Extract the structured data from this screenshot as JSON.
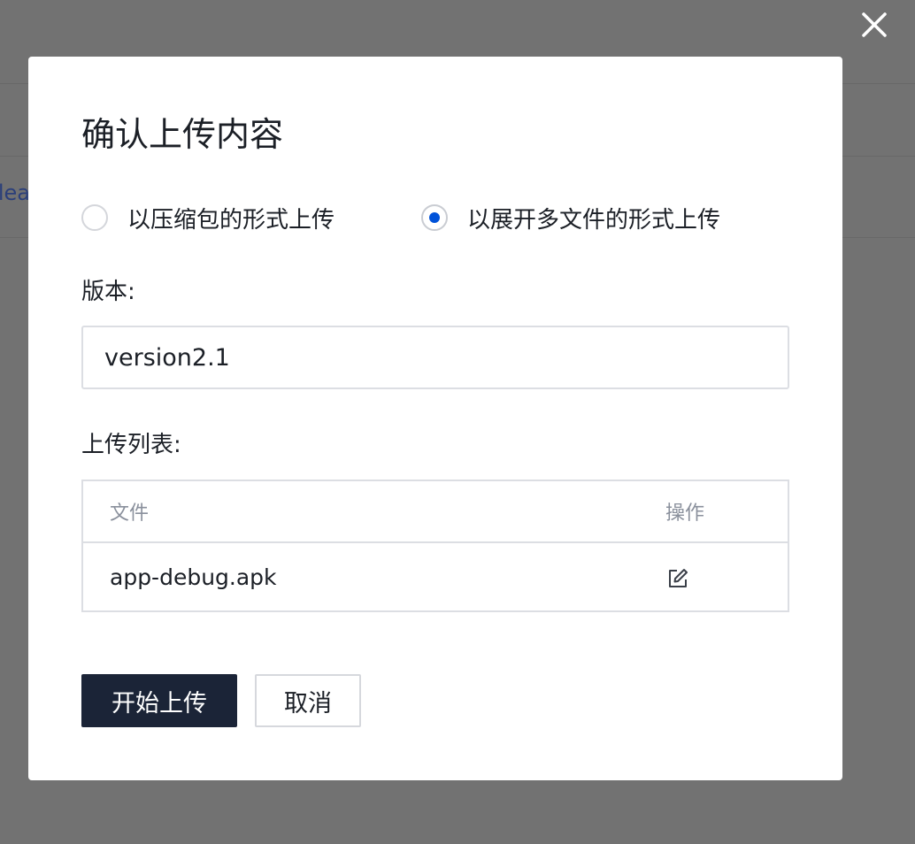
{
  "background": {
    "fragment_text": "lea"
  },
  "dialog": {
    "title": "确认上传内容",
    "upload_mode": {
      "options": [
        {
          "label": "以压缩包的形式上传",
          "checked": false
        },
        {
          "label": "以展开多文件的形式上传",
          "checked": true
        }
      ]
    },
    "version": {
      "label": "版本:",
      "value": "version2.1"
    },
    "upload_list": {
      "label": "上传列表:",
      "columns": [
        "文件",
        "操作"
      ],
      "rows": [
        {
          "file": "app-debug.apk",
          "action_icon": "edit-icon"
        }
      ]
    },
    "buttons": {
      "start_upload": "开始上传",
      "cancel": "取消"
    }
  },
  "icons": {
    "close": "close-icon",
    "edit": "edit-icon"
  },
  "colors": {
    "accent": "#0052d9",
    "primary_button": "#1b2437",
    "overlay": "#727272"
  }
}
